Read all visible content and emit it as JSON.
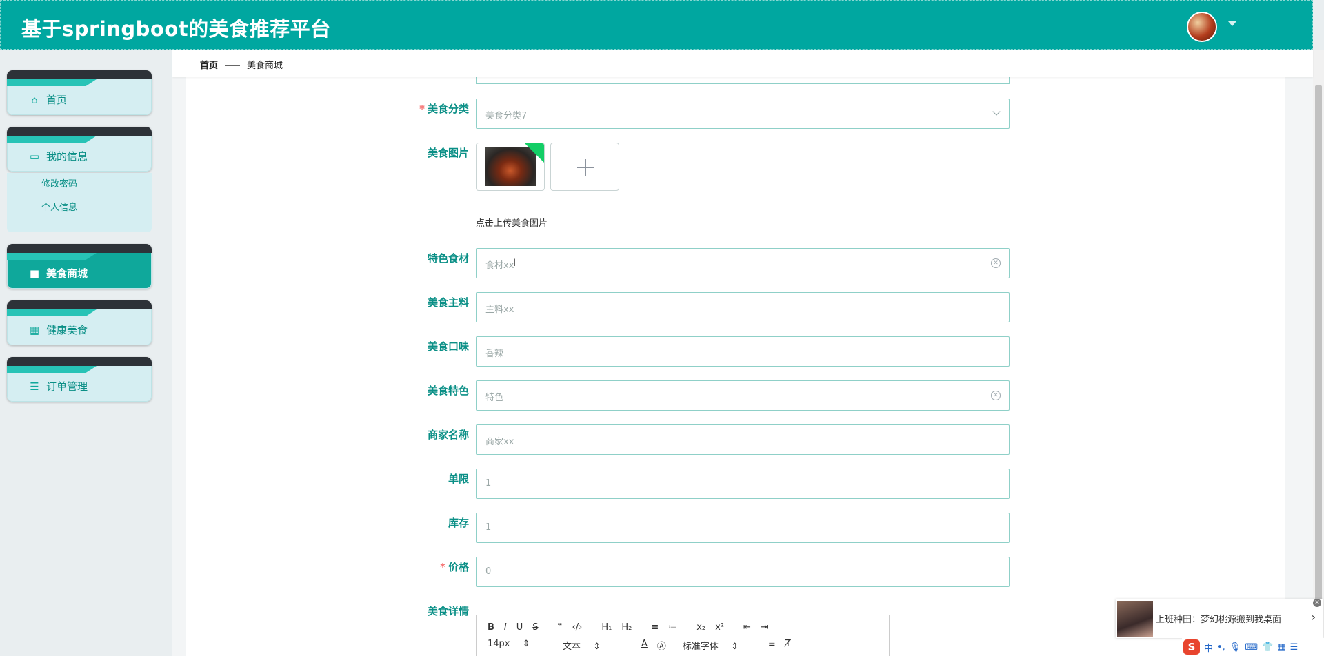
{
  "header": {
    "title": "基于springboot的美食推荐平台"
  },
  "sidebar": {
    "items": [
      {
        "label": "首页",
        "icon": "home-icon"
      },
      {
        "label": "我的信息",
        "icon": "card-icon"
      },
      {
        "label": "美食商城",
        "icon": "monitor-icon"
      },
      {
        "label": "健康美食",
        "icon": "grid-icon"
      },
      {
        "label": "订单管理",
        "icon": "list-icon"
      }
    ],
    "subitems": [
      "修改密码",
      "个人信息"
    ]
  },
  "breadcrumb": {
    "home": "首页",
    "current": "美食商城"
  },
  "form": {
    "category": {
      "label": "美食分类",
      "value": "美食分类7"
    },
    "image": {
      "label": "美食图片",
      "tip": "点击上传美食图片"
    },
    "ingredient": {
      "label": "特色食材",
      "value": "食材xx"
    },
    "main": {
      "label": "美食主料",
      "value": "主料xx"
    },
    "taste": {
      "label": "美食口味",
      "value": "香辣"
    },
    "feature": {
      "label": "美食特色",
      "value": "特色"
    },
    "merchant": {
      "label": "商家名称",
      "value": "商家xx"
    },
    "limit": {
      "label": "单限",
      "value": "1"
    },
    "stock": {
      "label": "库存",
      "value": "1"
    },
    "price": {
      "label": "价格",
      "value": "0"
    },
    "detail": {
      "label": "美食详情"
    },
    "required_mark": "*"
  },
  "editor": {
    "row1": [
      "B",
      "I",
      "U",
      "S",
      "❞",
      "‹/›",
      "H₁",
      "H₂",
      "≡",
      "≔",
      "x₂",
      "x²",
      "⇤",
      "⇥"
    ],
    "font_size": "14px",
    "paragraph": "文本",
    "font_family": "标准字体"
  },
  "notification": {
    "text": "上班种田：梦幻桃源搬到我桌面",
    "arrow": "›"
  },
  "tray": {
    "ime": "中"
  }
}
